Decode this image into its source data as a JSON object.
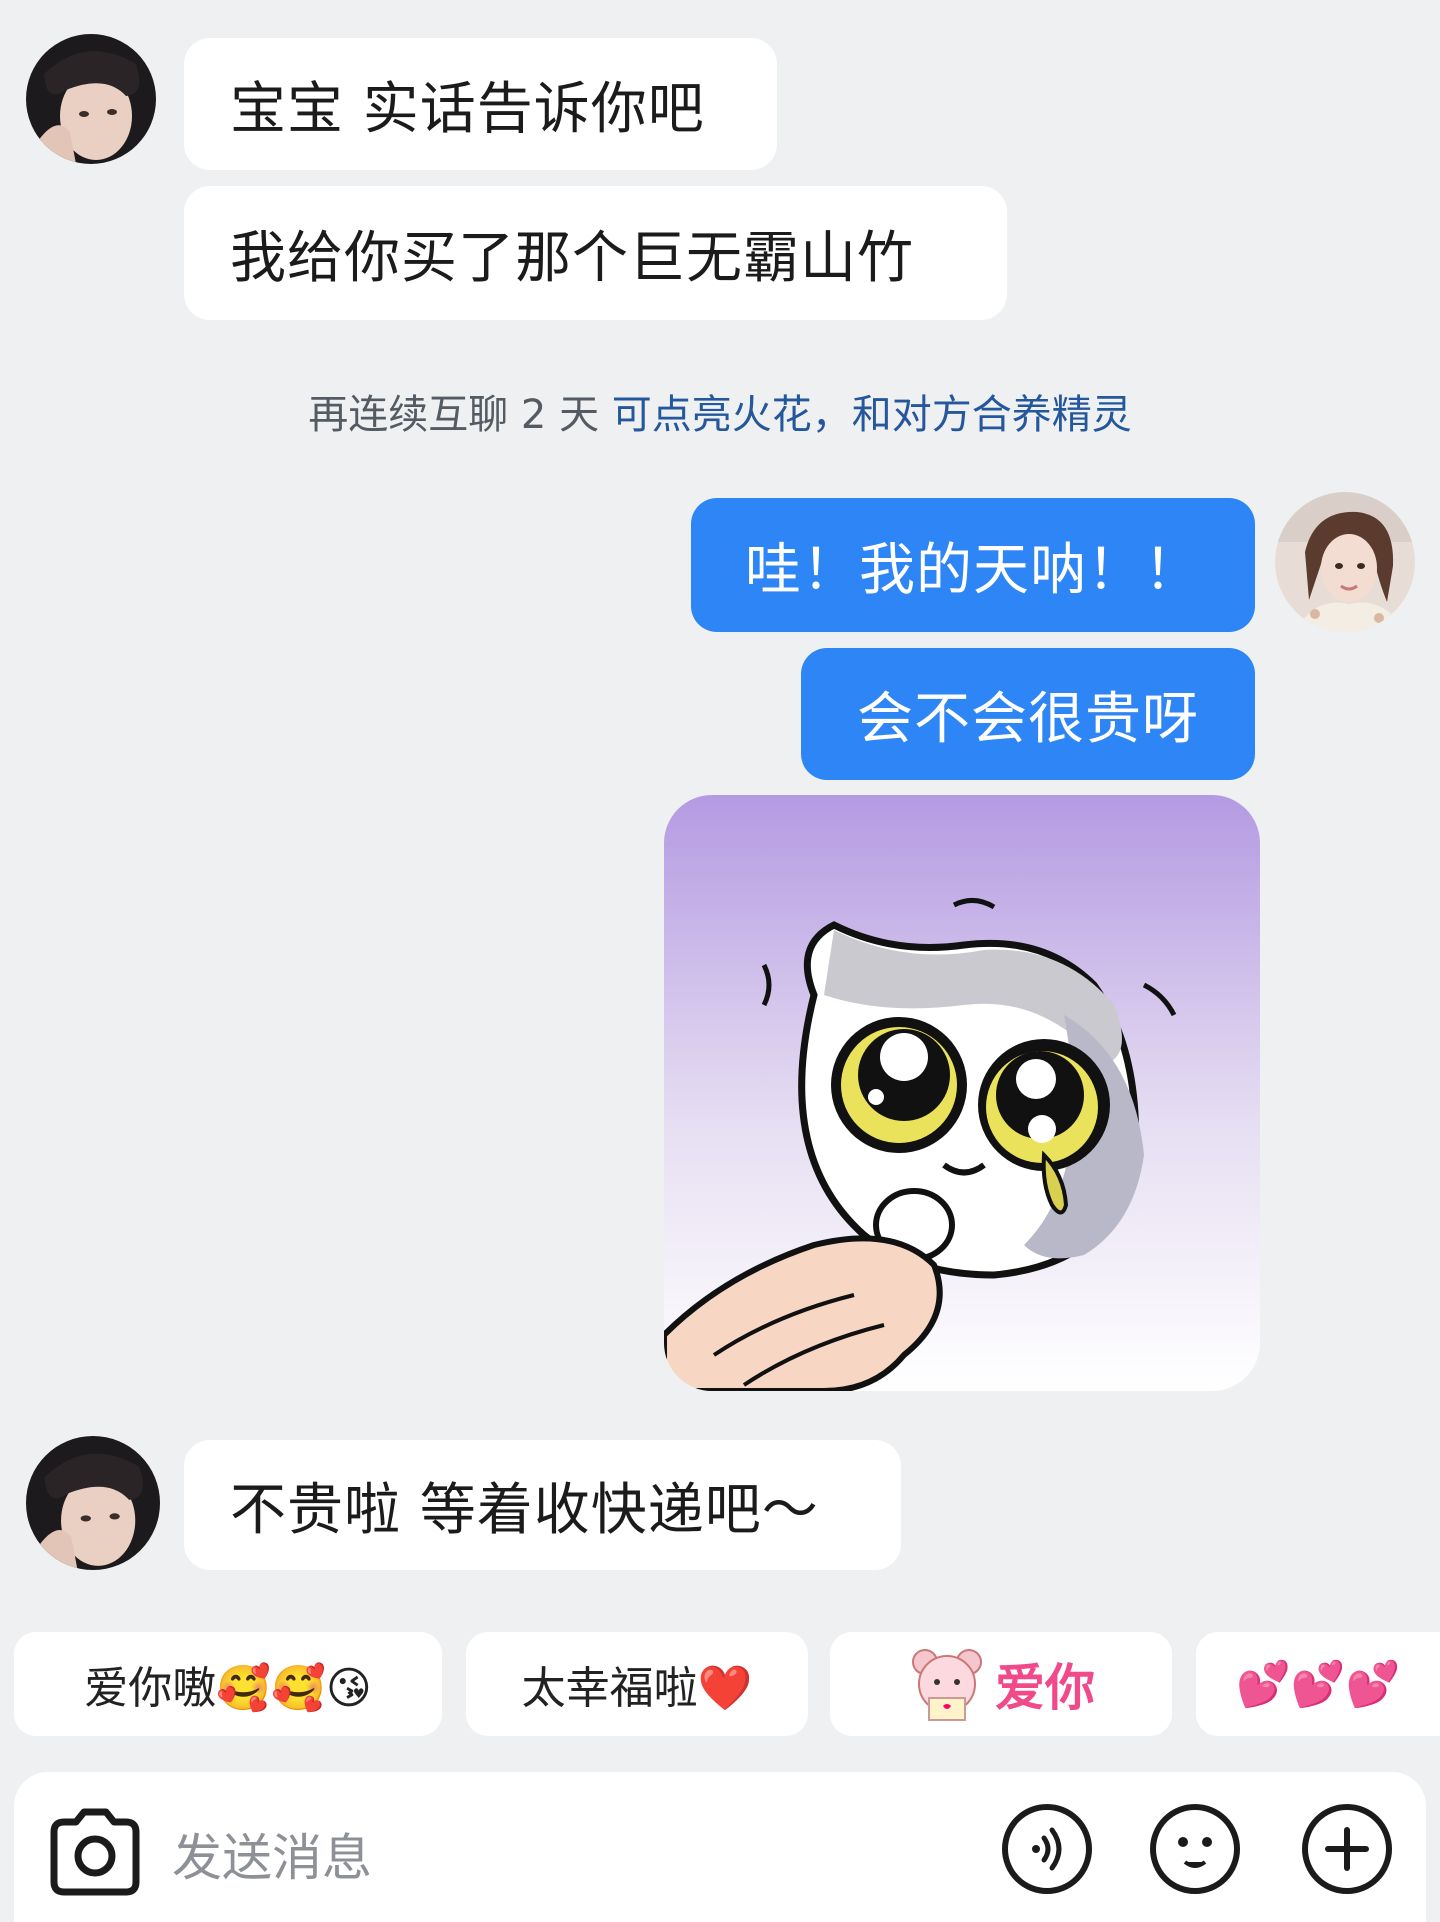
{
  "messages": {
    "m1": "宝宝 实话告诉你吧",
    "m2": "我给你买了那个巨无霸山竹",
    "m3": "哇！我的天呐！！",
    "m4": "会不会很贵呀",
    "m5": "不贵啦 等着收快递吧～"
  },
  "notice": {
    "prefix": "再连续互聊 2 天 ",
    "link": "可点亮火花，和对方合养精灵"
  },
  "quick_replies": {
    "q1": "爱你嗷🥰🥰😘",
    "q2": "太幸福啦❤️",
    "q3_sticker_text": "爱你",
    "q4_emoji": "💕💕💕"
  },
  "input": {
    "placeholder": "发送消息"
  },
  "icons": {
    "camera": "camera-icon",
    "voice": "voice-icon",
    "emoji": "emoji-icon",
    "plus": "plus-icon"
  },
  "colors": {
    "sent_bubble": "#2e85f5",
    "received_bubble": "#ffffff",
    "link": "#25579c",
    "background": "#eff0f2"
  }
}
